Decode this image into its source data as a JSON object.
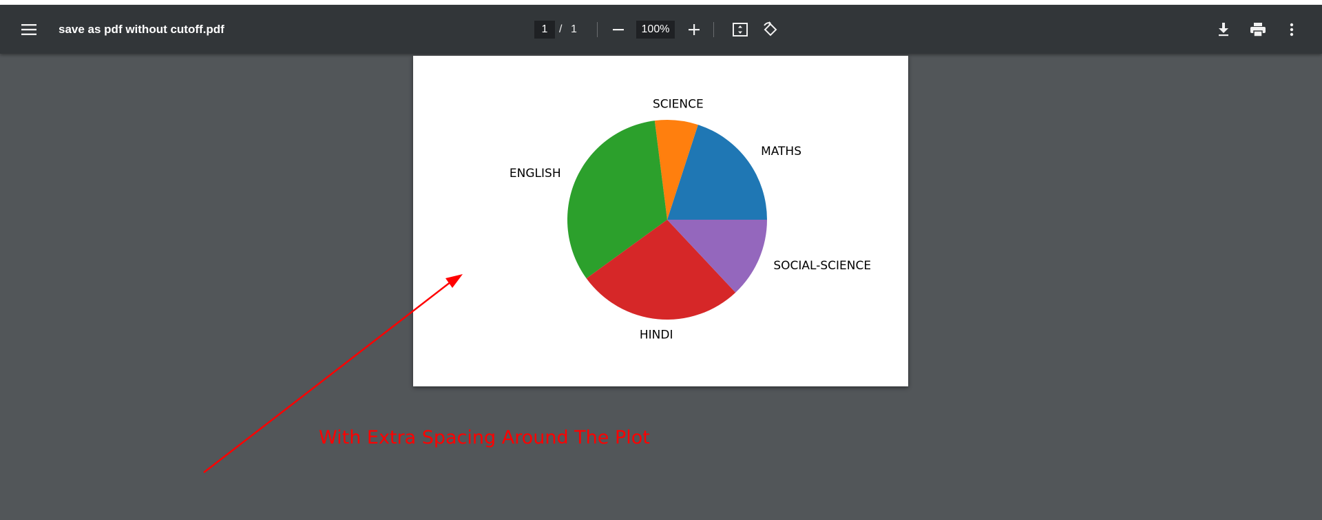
{
  "toolbar": {
    "menu_icon": "menu-icon",
    "title": "save as pdf without cutoff.pdf",
    "page_current": "1",
    "page_separator": "/",
    "page_total": "1",
    "zoom_out_icon": "minus-icon",
    "zoom_value": "100%",
    "zoom_in_icon": "plus-icon",
    "fit_icon": "fit-to-page-icon",
    "rotate_icon": "rotate-icon",
    "download_icon": "download-icon",
    "print_icon": "print-icon",
    "more_icon": "more-vert-icon"
  },
  "chart_data": {
    "type": "pie",
    "title": "",
    "categories": [
      "MATHS",
      "SCIENCE",
      "ENGLISH",
      "HINDI",
      "SOCIAL-SCIENCE"
    ],
    "values": [
      20,
      7,
      33,
      27,
      13
    ],
    "colors": [
      "#1f77b4",
      "#ff7f0e",
      "#2ca02c",
      "#d62728",
      "#9467bd"
    ],
    "start_angle_deg": 0,
    "legend": "none"
  },
  "annotation": {
    "text": "With Extra Spacing Around The Plot",
    "color": "#ff0000"
  },
  "colors": {
    "background": "#525659",
    "toolbar": "#323639",
    "page": "#ffffff"
  }
}
